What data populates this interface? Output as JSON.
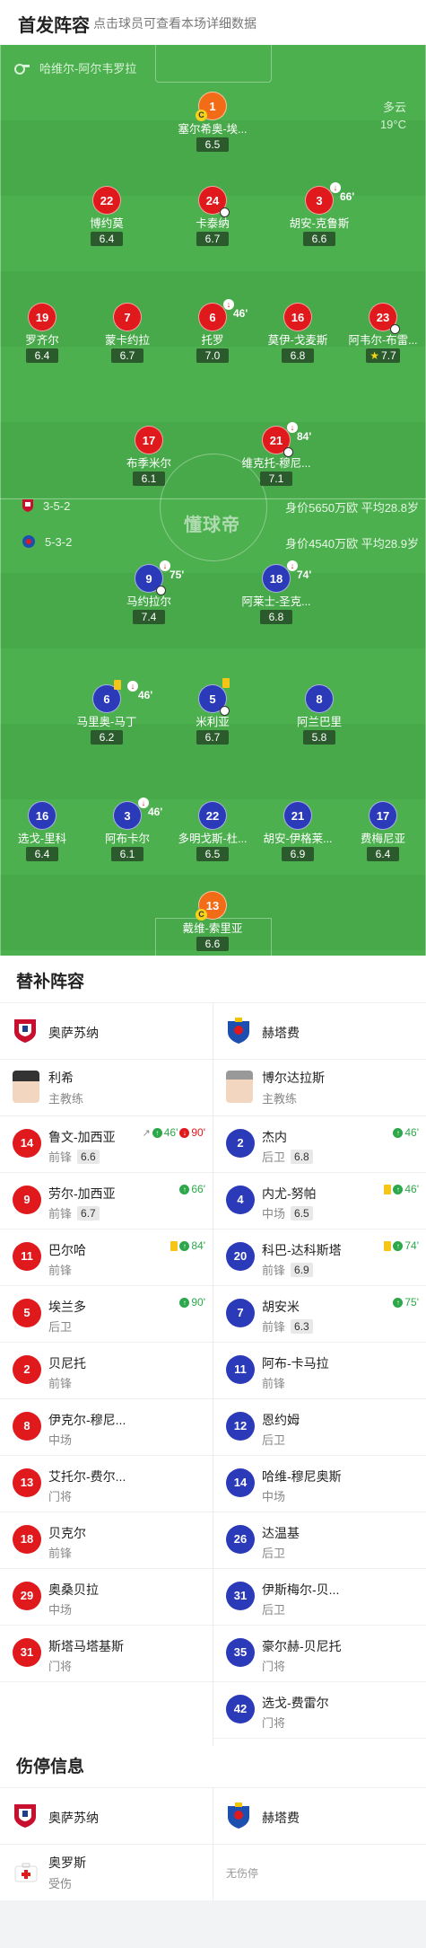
{
  "header": {
    "title": "首发阵容",
    "subtitle": "点击球员可查看本场详细数据"
  },
  "pitch": {
    "referee": "哈维尔-阿尔韦罗拉",
    "weather": "多云",
    "temperature": "19°C",
    "watermark": "懂球帝",
    "home_formation": "3-5-2",
    "home_value": "身价5650万欧 平均28.8岁",
    "away_formation": "5-3-2",
    "away_value": "身价4540万欧 平均28.9岁"
  },
  "home_players": [
    {
      "num": "1",
      "name": "塞尔希奥-埃...",
      "rating": "6.5",
      "gk": true,
      "captain": true
    },
    {
      "num": "22",
      "name": "博约莫",
      "rating": "6.4"
    },
    {
      "num": "24",
      "name": "卡泰纳",
      "rating": "6.7",
      "goal": true
    },
    {
      "num": "3",
      "name": "胡安-克鲁斯",
      "rating": "6.6",
      "sub_min": "66'"
    },
    {
      "num": "19",
      "name": "罗齐尔",
      "rating": "6.4"
    },
    {
      "num": "7",
      "name": "蒙卡约拉",
      "rating": "6.7"
    },
    {
      "num": "6",
      "name": "托罗",
      "rating": "7.0",
      "sub_min": "46'"
    },
    {
      "num": "16",
      "name": "莫伊-戈麦斯",
      "rating": "6.8"
    },
    {
      "num": "23",
      "name": "阿韦尔-布雷...",
      "rating": "7.7",
      "star": true,
      "goal": true
    },
    {
      "num": "17",
      "name": "布季米尔",
      "rating": "6.1"
    },
    {
      "num": "21",
      "name": "维克托-穆尼...",
      "rating": "7.1",
      "sub_min": "84'",
      "assist": true
    }
  ],
  "away_players": [
    {
      "num": "9",
      "name": "马约拉尔",
      "rating": "7.4",
      "sub_min": "75'",
      "goal": true
    },
    {
      "num": "18",
      "name": "阿莱士-圣克...",
      "rating": "6.8",
      "sub_min": "74'"
    },
    {
      "num": "6",
      "name": "马里奥-马丁",
      "rating": "6.2",
      "sub_min": "46'",
      "yellow": true
    },
    {
      "num": "5",
      "name": "米利亚",
      "rating": "6.7",
      "yellow": true,
      "assist": true
    },
    {
      "num": "8",
      "name": "阿兰巴里",
      "rating": "5.8"
    },
    {
      "num": "16",
      "name": "选戈-里科",
      "rating": "6.4"
    },
    {
      "num": "3",
      "name": "阿布卡尔",
      "rating": "6.1",
      "sub_min": "46'"
    },
    {
      "num": "22",
      "name": "多明戈斯-杜...",
      "rating": "6.5"
    },
    {
      "num": "21",
      "name": "胡安-伊格莱...",
      "rating": "6.9"
    },
    {
      "num": "17",
      "name": "费梅尼亚",
      "rating": "6.4"
    },
    {
      "num": "13",
      "name": "戴维-索里亚",
      "rating": "6.6",
      "gk": true,
      "captain": true
    }
  ],
  "subs": {
    "title": "替补阵容",
    "home_team": "奥萨苏纳",
    "away_team": "赫塔费",
    "home_coach": {
      "name": "利希",
      "role": "主教练"
    },
    "away_coach": {
      "name": "博尔达拉斯",
      "role": "主教练"
    },
    "home": [
      {
        "num": "14",
        "name": "鲁文-加西亚",
        "pos": "前锋",
        "rating": "6.6",
        "ev_in": "46'",
        "ev_out": "90'",
        "assist": true
      },
      {
        "num": "9",
        "name": "劳尔-加西亚",
        "pos": "前锋",
        "rating": "6.7",
        "ev_in": "66'"
      },
      {
        "num": "11",
        "name": "巴尔哈",
        "pos": "前锋",
        "ev_in": "84'",
        "yellow": true
      },
      {
        "num": "5",
        "name": "埃兰多",
        "pos": "后卫",
        "ev_in": "90'"
      },
      {
        "num": "2",
        "name": "贝尼托",
        "pos": "前锋"
      },
      {
        "num": "8",
        "name": "伊克尔-穆尼...",
        "pos": "中场"
      },
      {
        "num": "13",
        "name": "艾托尔-费尔...",
        "pos": "门将"
      },
      {
        "num": "18",
        "name": "贝克尔",
        "pos": "前锋"
      },
      {
        "num": "29",
        "name": "奥桑贝拉",
        "pos": "中场"
      },
      {
        "num": "31",
        "name": "斯塔马塔基斯",
        "pos": "门将"
      }
    ],
    "away": [
      {
        "num": "2",
        "name": "杰内",
        "pos": "后卫",
        "rating": "6.8",
        "ev_in": "46'"
      },
      {
        "num": "4",
        "name": "内尤-努帕",
        "pos": "中场",
        "rating": "6.5",
        "ev_in": "46'",
        "yellow": true
      },
      {
        "num": "20",
        "name": "科巴-达科斯塔",
        "pos": "前锋",
        "rating": "6.9",
        "ev_in": "74'",
        "yellow": true
      },
      {
        "num": "7",
        "name": "胡安米",
        "pos": "前锋",
        "rating": "6.3",
        "ev_in": "75'"
      },
      {
        "num": "11",
        "name": "阿布-卡马拉",
        "pos": "前锋"
      },
      {
        "num": "12",
        "name": "恩约姆",
        "pos": "后卫"
      },
      {
        "num": "14",
        "name": "哈维-穆尼奥斯",
        "pos": "中场"
      },
      {
        "num": "26",
        "name": "达温基",
        "pos": "后卫"
      },
      {
        "num": "31",
        "name": "伊斯梅尔-贝...",
        "pos": "后卫"
      },
      {
        "num": "35",
        "name": "豪尔赫-贝尼托",
        "pos": "门将"
      },
      {
        "num": "42",
        "name": "选戈-费雷尔",
        "pos": "门将"
      }
    ]
  },
  "injuries": {
    "title": "伤停信息",
    "home_team": "奥萨苏纳",
    "away_team": "赫塔费",
    "home": [
      {
        "name": "奥罗斯",
        "status": "受伤"
      }
    ],
    "away_none": "无伤停"
  }
}
